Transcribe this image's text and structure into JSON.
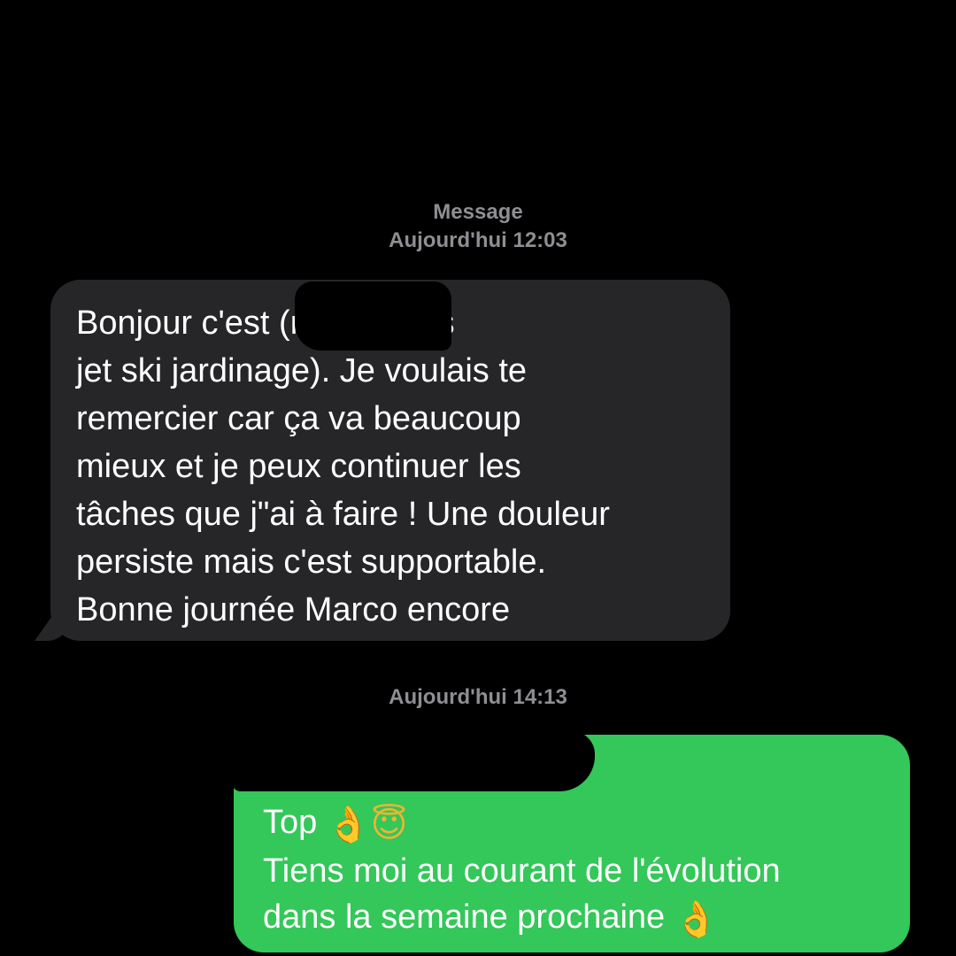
{
  "header": {
    "service_label": "Message",
    "first_timestamp": "Aujourd'hui 12:03",
    "second_timestamp": "Aujourd'hui 14:13"
  },
  "incoming_message": {
    "lines": [
      "Bonjour c'est              (mal de dos",
      "jet ski jardinage). Je voulais te",
      "remercier car ça va beaucoup",
      "mieux et je peux continuer les",
      "tâches que j\"ai à faire ! Une douleur",
      "persiste mais c'est supportable.",
      "Bonne journée Marco encore"
    ]
  },
  "outgoing_message": {
    "line1_text": "Top ",
    "line1_emoji_1": "👌",
    "line1_emoji_2": "😇",
    "line2": "Tiens moi au courant de l'évolution",
    "line3_text": "dans la semaine prochaine ",
    "line3_emoji": "👌"
  },
  "colors": {
    "background": "#000000",
    "incoming_bubble": "#262628",
    "outgoing_bubble": "#34c759",
    "meta_text": "#8e8e93"
  },
  "icons": [
    "ok-hand-emoji-icon",
    "smiling-face-with-halo-emoji-icon"
  ]
}
